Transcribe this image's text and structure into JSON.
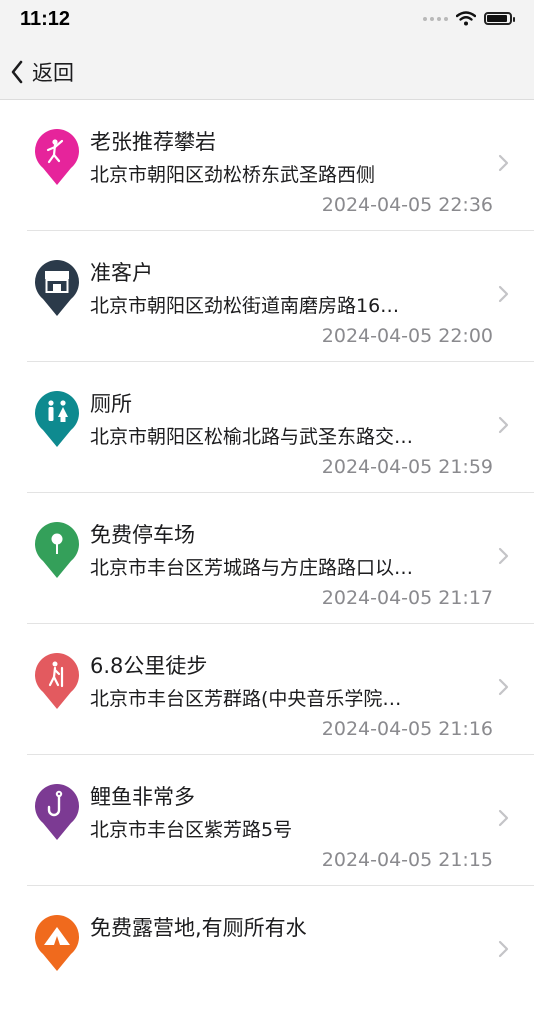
{
  "status": {
    "time": "11:12"
  },
  "nav": {
    "back_label": "返回"
  },
  "colors": {
    "pink": "#e6249b",
    "navy": "#2b3a4a",
    "teal": "#0e8a8f",
    "green": "#34a05a",
    "red": "#e35a5f",
    "purple": "#7c3a93",
    "orange": "#f06a1d"
  },
  "items": [
    {
      "title": "老张推荐攀岩",
      "address": "北京市朝阳区劲松桥东武圣路西侧",
      "time": "2024-04-05 22:36",
      "icon": "climbing-icon",
      "color": "#e6249b"
    },
    {
      "title": "准客户",
      "address": "北京市朝阳区劲松街道南磨房路16…",
      "time": "2024-04-05 22:00",
      "icon": "shop-icon",
      "color": "#2b3a4a"
    },
    {
      "title": "厕所",
      "address": "北京市朝阳区松榆北路与武圣东路交…",
      "time": "2024-04-05 21:59",
      "icon": "toilet-icon",
      "color": "#0e8a8f"
    },
    {
      "title": "免费停车场",
      "address": "北京市丰台区芳城路与方庄路路口以…",
      "time": "2024-04-05 21:17",
      "icon": "pin-icon",
      "color": "#34a05a"
    },
    {
      "title": "6.8公里徒步",
      "address": "北京市丰台区芳群路(中央音乐学院…",
      "time": "2024-04-05 21:16",
      "icon": "hiking-icon",
      "color": "#e35a5f"
    },
    {
      "title": "鲤鱼非常多",
      "address": "北京市丰台区紫芳路5号",
      "time": "2024-04-05 21:15",
      "icon": "fishing-hook-icon",
      "color": "#7c3a93"
    },
    {
      "title": "免费露营地,有厕所有水",
      "address": "",
      "time": "",
      "icon": "tent-icon",
      "color": "#f06a1d"
    }
  ]
}
